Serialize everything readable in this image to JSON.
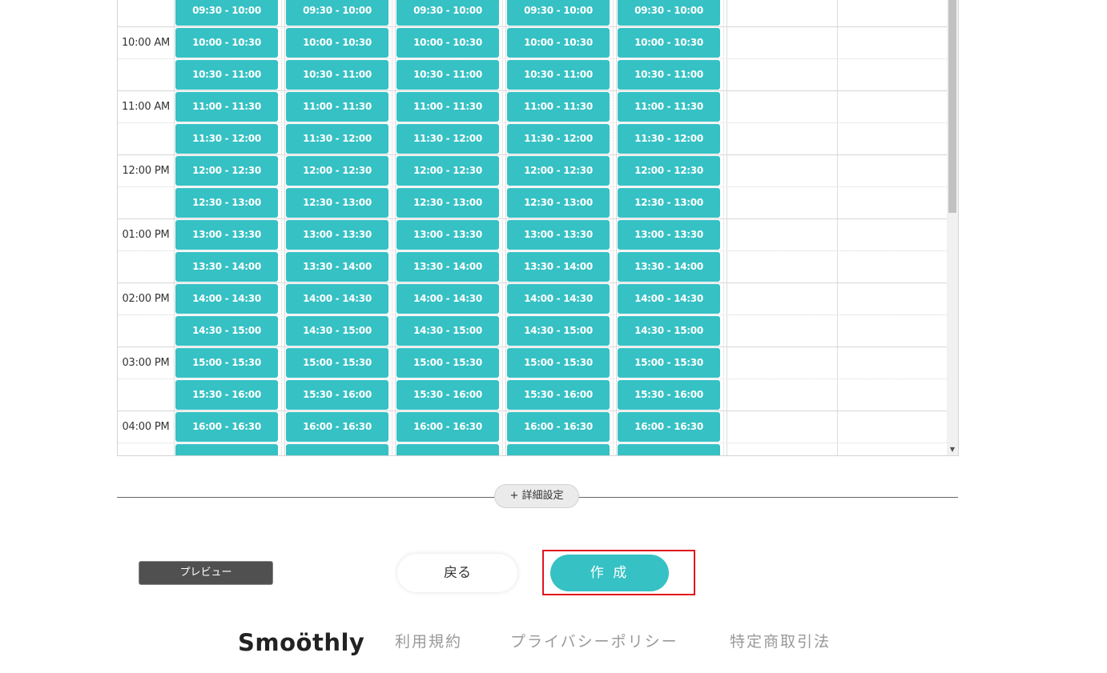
{
  "calendar": {
    "rows": [
      {
        "label": "",
        "slot": "09:30 - 10:00"
      },
      {
        "label": "10:00 AM",
        "slot": "10:00 - 10:30"
      },
      {
        "label": "",
        "slot": "10:30 - 11:00"
      },
      {
        "label": "11:00 AM",
        "slot": "11:00 - 11:30"
      },
      {
        "label": "",
        "slot": "11:30 - 12:00"
      },
      {
        "label": "12:00 PM",
        "slot": "12:00 - 12:30"
      },
      {
        "label": "",
        "slot": "12:30 - 13:00"
      },
      {
        "label": "01:00 PM",
        "slot": "13:00 - 13:30"
      },
      {
        "label": "",
        "slot": "13:30 - 14:00"
      },
      {
        "label": "02:00 PM",
        "slot": "14:00 - 14:30"
      },
      {
        "label": "",
        "slot": "14:30 - 15:00"
      },
      {
        "label": "03:00 PM",
        "slot": "15:00 - 15:30"
      },
      {
        "label": "",
        "slot": "15:30 - 16:00"
      },
      {
        "label": "04:00 PM",
        "slot": "16:00 - 16:30"
      },
      {
        "label": "",
        "slot": ""
      }
    ],
    "active_days": 5,
    "total_days": 7,
    "slot_color": "#36c1c4"
  },
  "detail_settings": "+ 詳細設定",
  "actions": {
    "preview": "プレビュー",
    "back": "戻る",
    "create": "作 成"
  },
  "footer": {
    "logo": "Smoöthly",
    "links": [
      "利用規約",
      "プライバシーポリシー",
      "特定商取引法"
    ]
  },
  "colors": {
    "accent": "#36c1c4",
    "highlight": "#e0161e"
  }
}
